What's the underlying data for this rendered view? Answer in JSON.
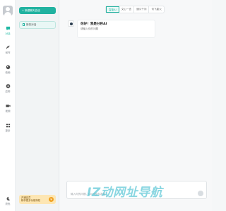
{
  "nav": {
    "items": [
      {
        "label": "对话",
        "icon": "chat-icon",
        "active": true
      },
      {
        "label": "创作",
        "icon": "feather-icon",
        "active": false
      },
      {
        "label": "绘画",
        "icon": "palette-icon",
        "active": false
      },
      {
        "label": "应用",
        "icon": "app-icon",
        "active": false
      },
      {
        "label": "视频",
        "icon": "video-icon",
        "active": false
      },
      {
        "label": "更多",
        "icon": "grid-icon",
        "active": false
      }
    ],
    "bottom_label": "亮色"
  },
  "sidebar": {
    "new_button_label": "+ 新建聊天会话",
    "conversation_label": "新的对话",
    "promo_line1": "开通会员",
    "promo_line2": "畅享更多功能特权",
    "promo_badge": "¥"
  },
  "main": {
    "tabs": [
      {
        "label": "智能AI",
        "active": true
      },
      {
        "label": "文心一言",
        "active": false
      },
      {
        "label": "通义千问",
        "active": false
      },
      {
        "label": "讯飞星火",
        "active": false
      }
    ],
    "greeting_title": "你好！我是分秒AI",
    "greeting_sub": "请输入你的问题",
    "input_placeholder": "输入你的问题，Ctrl+回车发送"
  },
  "watermark": "IZ动网址导航",
  "colors": {
    "accent": "#20b2a0",
    "promo": "#fde6b3"
  }
}
